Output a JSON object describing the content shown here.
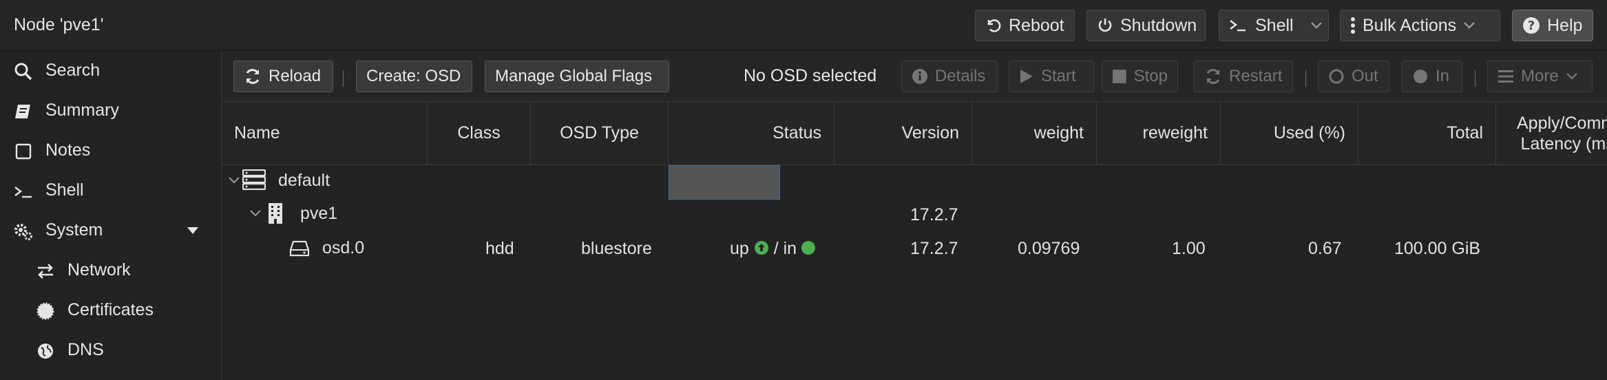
{
  "header": {
    "node_title": "Node 'pve1'",
    "reboot": "Reboot",
    "shutdown": "Shutdown",
    "shell": "Shell",
    "bulk_actions": "Bulk Actions",
    "help": "Help"
  },
  "sidebar": {
    "items": [
      {
        "label": "Search",
        "icon": "search-icon"
      },
      {
        "label": "Summary",
        "icon": "book-icon"
      },
      {
        "label": "Notes",
        "icon": "note-icon"
      },
      {
        "label": "Shell",
        "icon": "terminal-icon"
      },
      {
        "label": "System",
        "icon": "gears-icon"
      },
      {
        "label": "Network",
        "icon": "exchange-icon"
      },
      {
        "label": "Certificates",
        "icon": "certificate-icon"
      },
      {
        "label": "DNS",
        "icon": "globe-icon"
      }
    ]
  },
  "toolbar": {
    "reload": "Reload",
    "create_osd": "Create: OSD",
    "manage_flags": "Manage Global Flags",
    "no_osd": "No OSD selected",
    "details": "Details",
    "start": "Start",
    "stop": "Stop",
    "restart": "Restart",
    "out": "Out",
    "in": "In",
    "more": "More"
  },
  "table": {
    "columns": [
      "Name",
      "Class",
      "OSD Type",
      "Status",
      "Version",
      "weight",
      "reweight",
      "Used (%)",
      "Total",
      "Apply/Commit\nLatency (ms)"
    ],
    "rows": {
      "default": {
        "name": "default"
      },
      "host": {
        "name": "pve1",
        "version": "17.2.7"
      },
      "osd": {
        "name": "osd.0",
        "class": "hdd",
        "osd_type": "bluestore",
        "status_up": "up",
        "status_sep": "/ in",
        "version": "17.2.7",
        "weight": "0.09769",
        "reweight": "1.00",
        "used": "0.67",
        "total": "100.00 GiB"
      }
    }
  },
  "colors": {
    "status_ok": "#4caf50",
    "selection_border": "#3f6d9e"
  }
}
